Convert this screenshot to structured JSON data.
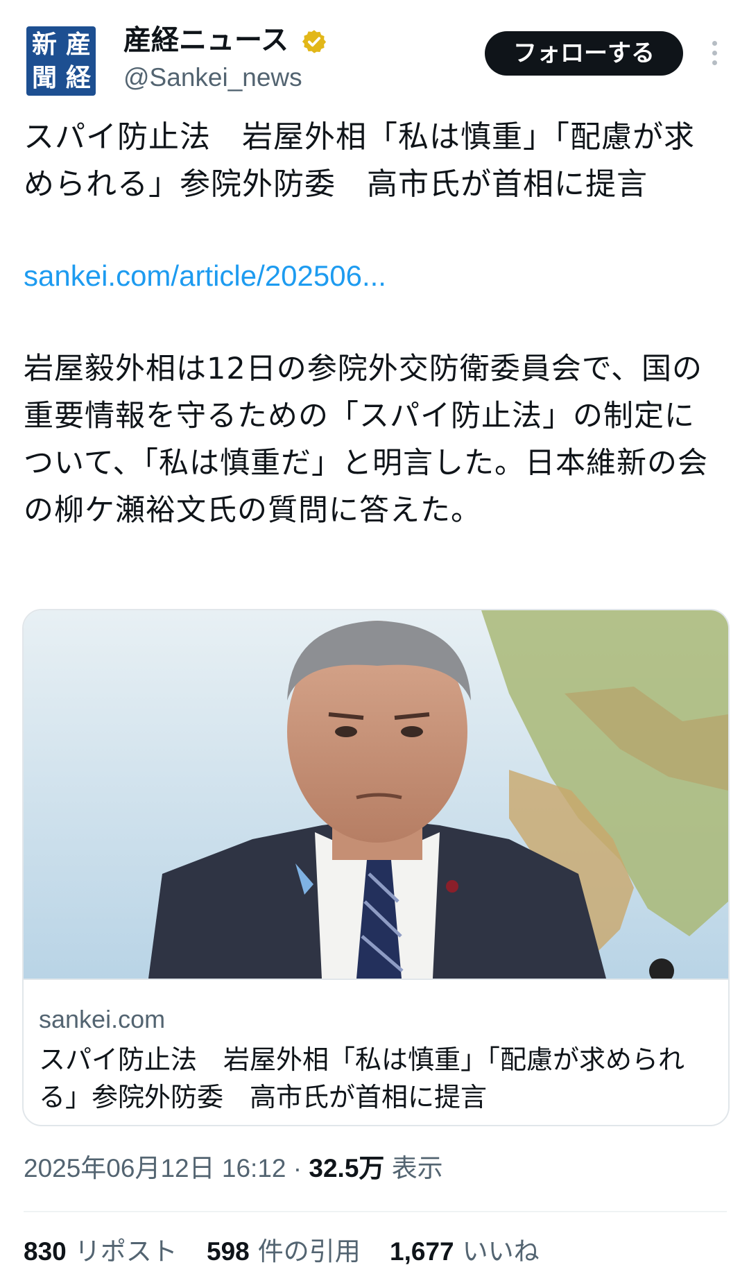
{
  "account": {
    "display_name": "産経ニュース",
    "handle": "@Sankei_news",
    "logo_chars": [
      "産",
      "経",
      "新",
      "聞"
    ],
    "verified_color": "#e2b719"
  },
  "follow_label": "フォローする",
  "more_icon": "more-vertical-icon",
  "post": {
    "title": "スパイ防止法　岩屋外相「私は慎重」「配慮が求められる」参院外防委　高市氏が首相に提言",
    "link": "sankei.com/article/202506...",
    "body": "岩屋毅外相は12日の参院外交防衛委員会で、国の重要情報を守るための「スパイ防止法」の制定について、「私は慎重だ」と明言した。日本維新の会の柳ケ瀬裕文氏の質問に答えた。"
  },
  "card": {
    "domain": "sankei.com",
    "title": "スパイ防止法　岩屋外相「私は慎重」「配慮が求められる」参院外防委　高市氏が首相に提言"
  },
  "meta": {
    "timestamp": "2025年06月12日 16:12",
    "separator": "·",
    "views": "32.5万",
    "views_label": "表示"
  },
  "stats": {
    "reposts": "830",
    "reposts_label": "リポスト",
    "quotes": "598",
    "quotes_label": "件の引用",
    "likes": "1,677",
    "likes_label": "いいね"
  },
  "colors": {
    "link": "#1d9bf0",
    "follow_bg": "#0f1419",
    "logo_bg": "#1d4f91"
  }
}
